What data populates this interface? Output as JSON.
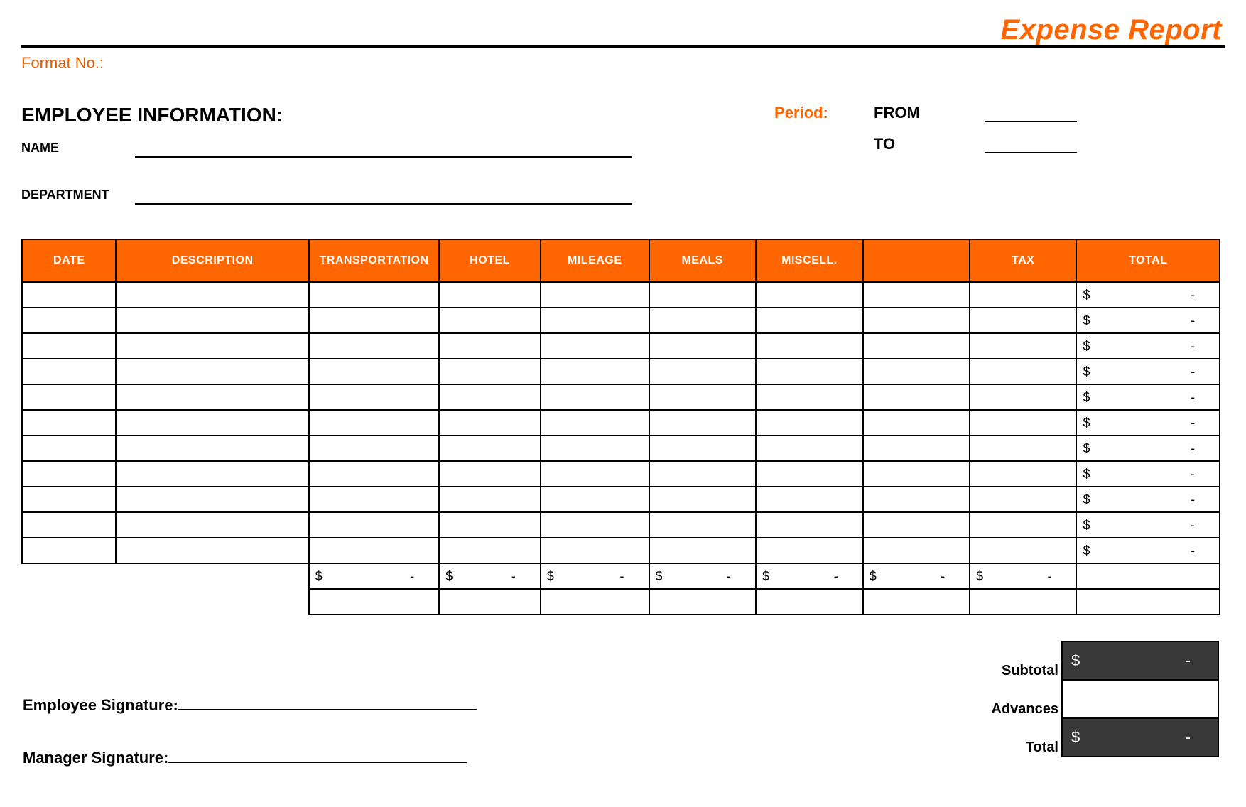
{
  "title": "Expense Report",
  "format_no_label": "Format No.:",
  "employee_section": {
    "heading": "EMPLOYEE INFORMATION:",
    "name_label": "NAME",
    "department_label": "DEPARTMENT",
    "period_label": "Period:",
    "from_label": "FROM",
    "to_label": "TO"
  },
  "table": {
    "columns": {
      "date": "DATE",
      "description": "DESCRIPTION",
      "transportation": "TRANSPORTATION",
      "hotel": "HOTEL",
      "mileage": "MILEAGE",
      "meals": "MEALS",
      "miscell": "MISCELL.",
      "blank": "",
      "tax": "TAX",
      "total": "TOTAL"
    },
    "total_cell": {
      "symbol": "$",
      "value": "-"
    },
    "col_total_cell": {
      "symbol": "$",
      "value": "-"
    }
  },
  "signatures": {
    "employee": "Employee Signature:",
    "manager": "Manager Signature:"
  },
  "summary": {
    "subtotal_label": "Subtotal",
    "advances_label": "Advances",
    "total_label": "Total",
    "subtotal": {
      "symbol": "$",
      "value": "-"
    },
    "total": {
      "symbol": "$",
      "value": "-"
    }
  }
}
